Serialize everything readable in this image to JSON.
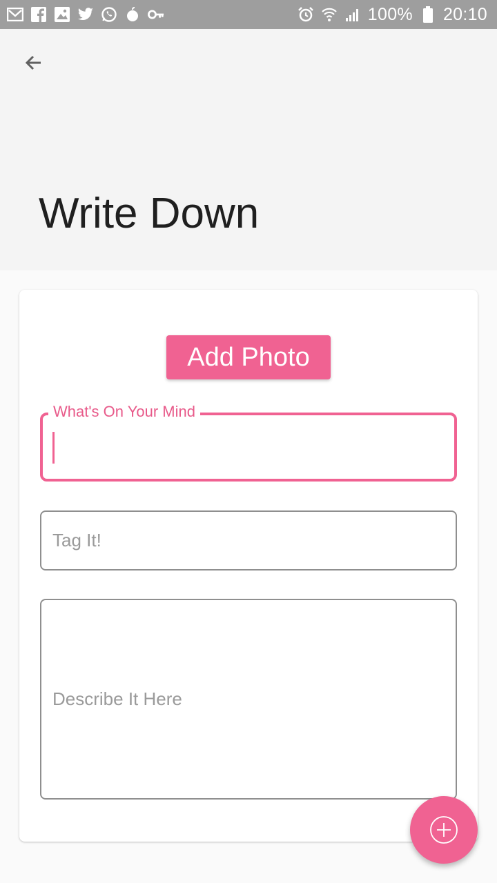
{
  "status_bar": {
    "left_icons": [
      "gmail-icon",
      "facebook-icon",
      "gallery-icon",
      "twitter-icon",
      "whatsapp-icon",
      "drop-icon",
      "key-icon"
    ],
    "right_icons": [
      "alarm-icon",
      "wifi-icon",
      "signal-icon",
      "battery-icon"
    ],
    "battery": "100%",
    "time": "20:10"
  },
  "header": {
    "back_icon": "arrow-left-icon",
    "title": "Write Down"
  },
  "form": {
    "add_photo_label": "Add Photo",
    "mind_field": {
      "label": "What's On Your Mind",
      "value": ""
    },
    "tag_field": {
      "placeholder": "Tag It!",
      "value": ""
    },
    "description_field": {
      "placeholder": "Describe It Here",
      "value": ""
    }
  },
  "fab": {
    "icon": "add-circle-icon"
  },
  "colors": {
    "accent": "#f06292",
    "status_bar": "#9e9e9e",
    "header_bg": "#f4f4f4",
    "page_bg": "#fafafa"
  }
}
